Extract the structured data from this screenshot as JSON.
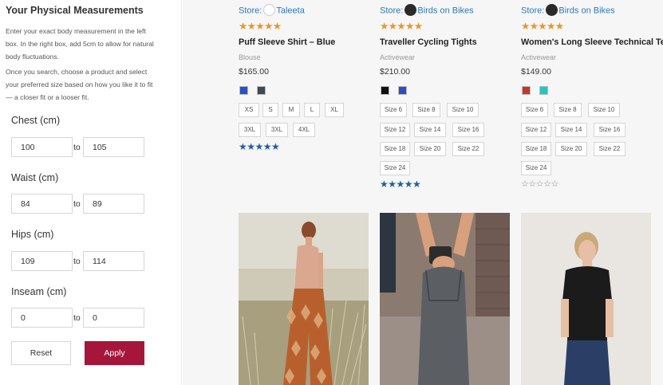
{
  "sidebar": {
    "title": "Your Physical Measurements",
    "intro1": "Enter your exact body measurement in the left box. In the right box, add 5cm to allow for natural body fluctuations.",
    "intro2": "Once you search, choose a product and select your preferred size based on how you like it to fit — a closer fit or a looser fit.",
    "fields": [
      {
        "label": "Chest (cm)",
        "min": "100",
        "max": "105",
        "to": "to"
      },
      {
        "label": "Waist (cm)",
        "min": "84",
        "max": "89",
        "to": "to"
      },
      {
        "label": "Hips (cm)",
        "min": "109",
        "max": "114",
        "to": "to"
      },
      {
        "label": "Inseam (cm)",
        "min": "0",
        "max": "0",
        "to": "to"
      }
    ],
    "reset_label": "Reset",
    "apply_label": "Apply"
  },
  "products": [
    {
      "store_prefix": "Store:",
      "store_name": "Taleeta",
      "stars_top": "★★★★★",
      "name": "Puff Sleeve Shirt – Blue",
      "category": "Blouse",
      "price": "$165.00",
      "swatch_colors": [
        "#2b4fc4",
        "#3e4a55"
      ],
      "sizes": [
        "XS",
        "S",
        "M",
        "L",
        "XL",
        "3XL",
        "3XL",
        "4XL"
      ],
      "rating_stars": "★★★★★"
    },
    {
      "store_prefix": "Store:",
      "store_name": "Birds on Bikes",
      "stars_top": "★★★★★",
      "name": "Traveller Cycling Tights",
      "category": "Activewear",
      "price": "$210.00",
      "swatch_colors": [
        "#111111",
        "#2b4fc4"
      ],
      "sizes": [
        "Size 6",
        "Size 8",
        "Size 10",
        "Size 12",
        "Size 14",
        "Size 16",
        "Size 18",
        "Size 20",
        "Size 22",
        "Size 24"
      ],
      "rating_stars": "★★★★★"
    },
    {
      "store_prefix": "Store:",
      "store_name": "Birds on Bikes",
      "stars_top": "★★★★★",
      "name": "Women's Long Sleeve Technical Tee",
      "category": "Activewear",
      "price": "$149.00",
      "swatch_colors": [
        "#c0392b",
        "#1cc9c0"
      ],
      "sizes": [
        "Size 6",
        "Size 8",
        "Size 10",
        "Size 12",
        "Size 14",
        "Size 16",
        "Size 18",
        "Size 20",
        "Size 22",
        "Size 24"
      ],
      "rating_stars": "☆☆☆☆☆"
    }
  ],
  "colors": {
    "accent": "#a6163b",
    "link": "#2e7ab8",
    "star_orange": "#e8962c",
    "star_blue": "#1f5ea8"
  }
}
